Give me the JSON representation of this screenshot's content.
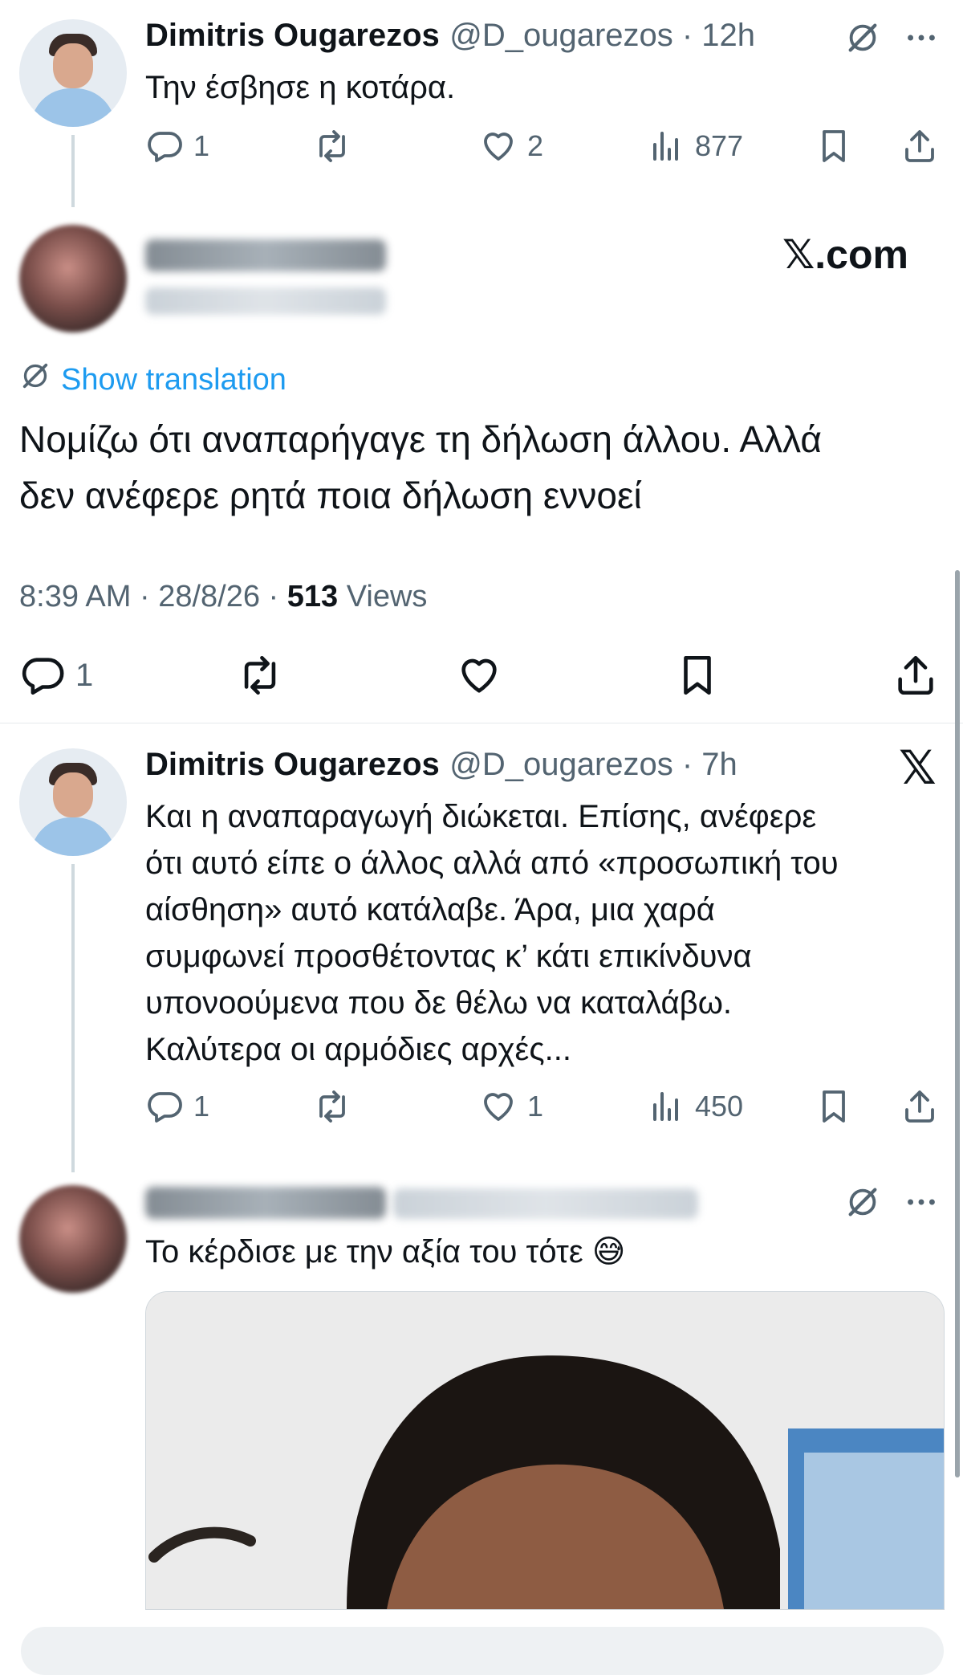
{
  "tweet1": {
    "name": "Dimitris Ougarezos",
    "handle": "@D_ougarezos · 12h",
    "text": "Την έσβησε η κοτάρα.",
    "replies": "1",
    "likes": "2",
    "views": "877"
  },
  "main_tweet": {
    "brand": "𝕏.com",
    "show_translation": "Show translation",
    "text_line1": "Νομίζω ότι αναπαρήγαγε τη δήλωση άλλου. Αλλά",
    "text_line2": "δεν ανέφερε ρητά ποια δήλωση εννοεί",
    "time": "8:39 AM · 28/8/26 · ",
    "views_count": "513",
    "views_label": " Views",
    "replies": "1"
  },
  "tweet2": {
    "name": "Dimitris Ougarezos",
    "handle": "@D_ougarezos · 7h",
    "x_logo": "𝕏",
    "lines": [
      "Και η αναπαραγωγή διώκεται. Επίσης, ανέφερε",
      "ότι αυτό είπε ο άλλος αλλά από «προσωπική του",
      "αίσθηση» αυτό κατάλαβε. Άρα, μια χαρά",
      "συμφωνεί προσθέτοντας κ’ κάτι επικίνδυνα",
      "υπονοούμενα που δε θέλω να καταλάβω.",
      "Καλύτερα οι αρμόδιες αρχές..."
    ],
    "replies": "1",
    "likes": "1",
    "views": "450"
  },
  "tweet3": {
    "text": "Το κέρδισε με την αξία του τότε 😅"
  },
  "icons": {
    "reply": "reply-icon",
    "retweet": "retweet-icon",
    "like": "heart-icon",
    "views": "views-icon",
    "bookmark": "bookmark-icon",
    "share": "share-icon",
    "grok": "grok-icon",
    "more": "more-icon"
  },
  "colors": {
    "link": "#1d9bf0",
    "muted": "#536471",
    "text": "#0f1419"
  }
}
